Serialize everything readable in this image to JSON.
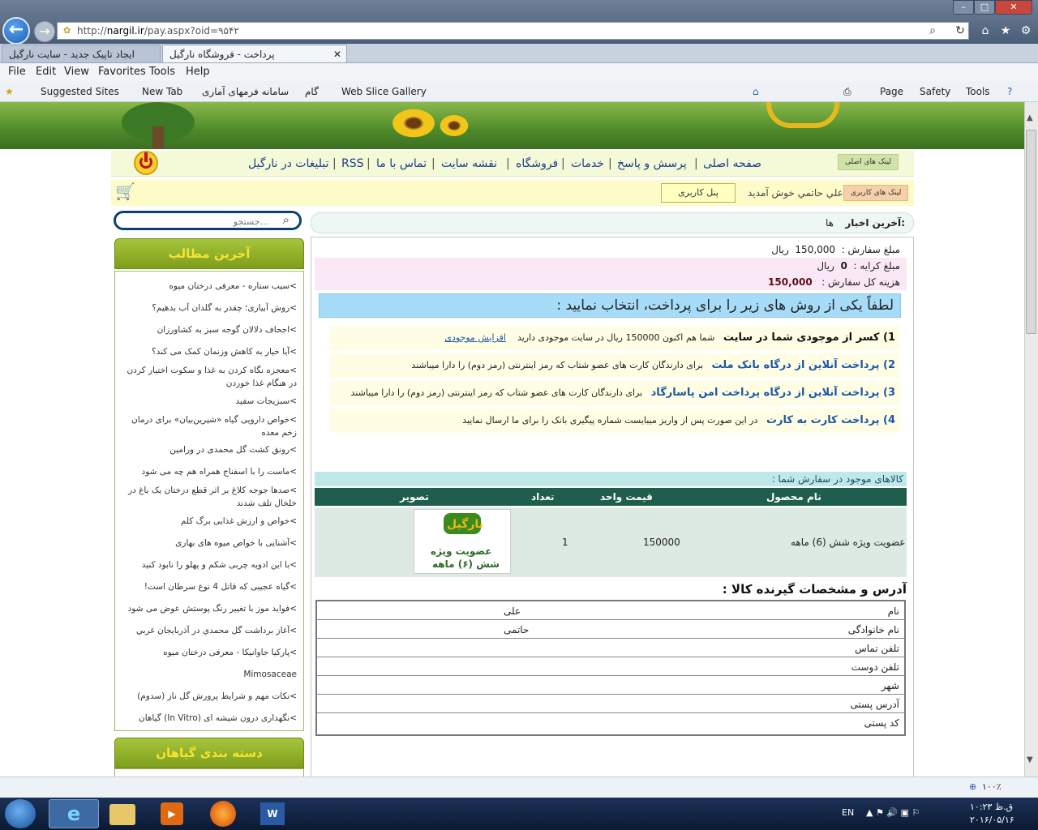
{
  "browser": {
    "url_prefix": "http://",
    "url_domain": "nargil.ir",
    "url_path": "/pay.aspx?oid=۹۵۴۲",
    "tabs": [
      {
        "label": "ایجاد تاپیک جدید - سایت نارگیل"
      },
      {
        "label": "پرداخت - فروشگاه نارگیل"
      }
    ],
    "menu": [
      "File",
      "Edit",
      "View",
      "Favorites",
      "Tools",
      "Help"
    ],
    "favorites": [
      "Suggested Sites",
      "New Tab",
      "سامانه فرمهای آماری",
      "گام",
      "Web Slice Gallery"
    ],
    "command_bar": [
      "Page",
      "Safety",
      "Tools"
    ],
    "zoom": "۱۰۰٪"
  },
  "site": {
    "main_links_label": "لینک های اصلی",
    "user_links_label": "لینک های کاربری",
    "nav": [
      "صفحه اصلی",
      "پرسش و پاسخ",
      "خدمات",
      "فروشگاه",
      "نقشه سایت",
      "تماس با ما",
      "RSS",
      "تبلیغات در نارگیل"
    ],
    "welcome": "علي حاتمي خوش آمدید",
    "user_panel": "پنل کاربری",
    "search_placeholder": "جستجو...",
    "latest_news_label": "آخرین اخبار:",
    "latest_news_text": "ها"
  },
  "sidebar": {
    "latest_title": "آخرین مطالب",
    "categories_title": "دسته بندی گیاهان",
    "items": [
      "سیب ستاره - معرفی درختان میوه",
      "روش آبیاری؛ چقدر به گلدان آب بدهیم؟",
      "اجحاف دلالان گوجه سبز به کشاورزان",
      "آیا خیار به کاهش وزنمان کمک می کند؟",
      "معجزه نگاه کردن به غذا و سکوت اختیار کردن در هنگام غذا خوردن",
      "سبزیجات سفید",
      "خواص دارویی گیاه «شیرین‌بیان» برای درمان زخم معده",
      "رونق کشت گل محمدی در ورامین",
      "ماست را با اسفناج همراه هم چه می شود",
      "صدها جوجه کلاغ بر اثر قطع درختان یک باغ در خلخال تلف شدند",
      "خواص و ارزش غذایی برگ کلم",
      "آشنایی با خواص میوه های بهاری",
      "با این ادویه چربی شکم و پهلو را نابود کنید",
      "گیاه عجیبی که قاتل 4 نوع سرطان است!",
      "فواید موز با تغییر رنگ پوستش عوض می شود",
      "آغاز برداشت گل محمدي در آذربايجان غربي",
      "پارکیا جاوانیکا - معرفی درختان میوه",
      "Mimosaceae",
      "نکات مهم و شرایط پرورش گل ناز (سدوم)",
      "نگهداری درون شیشه ای (In Vitro) گیاهان"
    ]
  },
  "order": {
    "amount_label": "مبلغ سفارش :",
    "amount_value": "150,000",
    "amount_unit": "ریال",
    "fare_label": "مبلغ کرایه :",
    "fare_value": "0",
    "fare_unit": "ریال",
    "total_label": "هزینه کل سفارش :",
    "total_value": "150,000"
  },
  "payment": {
    "title": "لطفاً یکی از روش های زیر را برای پرداخت، انتخاب نمایید :",
    "methods": [
      {
        "title": "1) کسر از موجودی شما در سایت",
        "desc": "شما هم اکنون 150000 ریال در سایت موجودی دارید",
        "link": "افزایش موجودی"
      },
      {
        "title": "2) پرداخت آنلاین از درگاه بانک ملت",
        "desc": "برای دارندگان کارت های عضو شتاب که رمز اینترنتی (رمز دوم) را دارا میباشند"
      },
      {
        "title": "3) پرداخت آنلاین از درگاه پرداخت امن پاسارگاد",
        "desc": "برای دارندگان کارت های عضو شتاب که رمز اینترنتی (رمز دوم) را دارا میباشند"
      },
      {
        "title": "4) پرداخت کارت به کارت",
        "desc": "در این صورت پس از واریز میبایست شماره پیگیری بانک را برای ما ارسال نمایید"
      }
    ]
  },
  "items": {
    "label": "کالاهای موجود در سفارش شما :",
    "headers": [
      "نام محصول",
      "قیمت واحد",
      "تعداد",
      "تصویر"
    ],
    "row": {
      "name": "عضویت ویژه شش (6) ماهه",
      "price": "150000",
      "qty": "1",
      "img_logo": "نارگیل",
      "img_line1": "عضویت ویژه",
      "img_line2": "شش (۶) ماهه"
    }
  },
  "address": {
    "title": "آدرس و مشخصات گیرنده کالا :",
    "rows": [
      {
        "k": "نام",
        "v": "علی"
      },
      {
        "k": "نام خانوادگی",
        "v": "حاتمی"
      },
      {
        "k": "تلفن تماس",
        "v": ""
      },
      {
        "k": "تلفن دوست",
        "v": ""
      },
      {
        "k": "شهر",
        "v": ""
      },
      {
        "k": "آدرس پستی",
        "v": ""
      },
      {
        "k": "کد پستی",
        "v": ""
      }
    ]
  },
  "taskbar": {
    "lang": "EN",
    "time": "ق.ظ ۱۰:۲۳",
    "date": "۲۰۱۶/۰۵/۱۶"
  }
}
